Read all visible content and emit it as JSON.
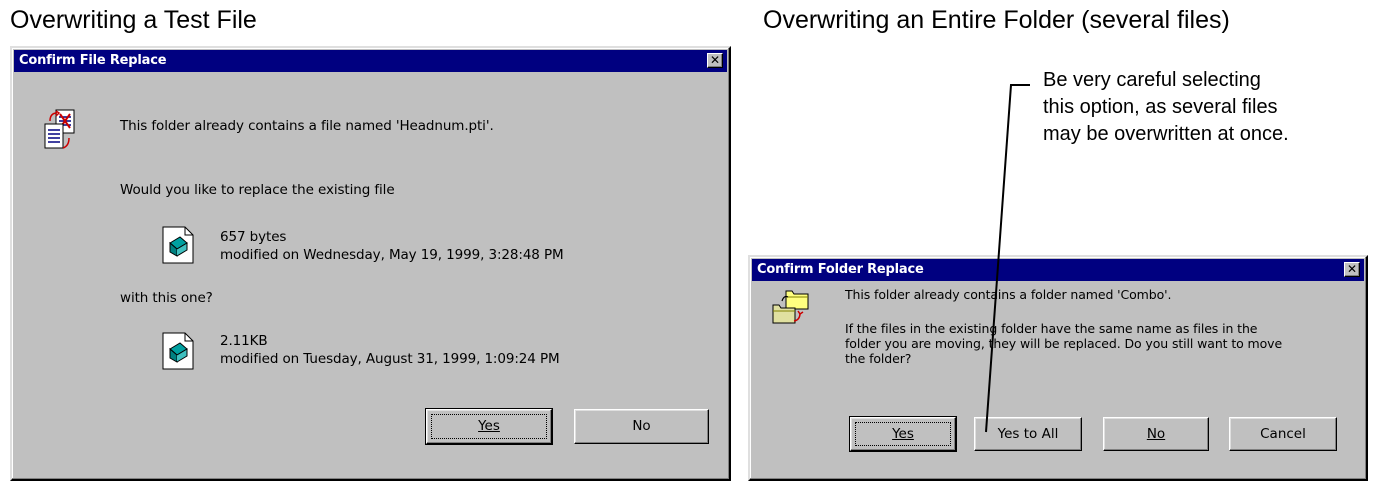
{
  "headings": {
    "left": "Overwriting a Test File",
    "right": "Overwriting an Entire Folder (several files)"
  },
  "annotation": {
    "lines": [
      "Be very careful selecting",
      "this option, as several files",
      "may be overwritten at once."
    ]
  },
  "file_dialog": {
    "title": "Confirm File Replace",
    "close": "✕",
    "message": "This folder already contains a file named 'Headnum.pti'.",
    "question": "Would you like to replace the existing file",
    "existing": {
      "size": "657 bytes",
      "modified": "modified on Wednesday, May 19, 1999, 3:28:48 PM"
    },
    "with_label": "with this one?",
    "new": {
      "size": "2.11KB",
      "modified": "modified on Tuesday, August 31, 1999, 1:09:24 PM"
    },
    "buttons": {
      "yes": "Yes",
      "no": "No"
    }
  },
  "folder_dialog": {
    "title": "Confirm Folder Replace",
    "close": "✕",
    "message": "This folder already contains a folder named 'Combo'.",
    "body_lines": [
      "If the files in the existing folder have the same name as files in the",
      "folder you are moving, they will be replaced.  Do you still want to move",
      "the folder?"
    ],
    "buttons": {
      "yes": "Yes",
      "yes_to_all": "Yes to All",
      "no": "No",
      "cancel": "Cancel"
    }
  },
  "colors": {
    "dialog_face": "#c0c0c0",
    "titlebar": "#000080",
    "titlebar_text": "#ffffff"
  }
}
